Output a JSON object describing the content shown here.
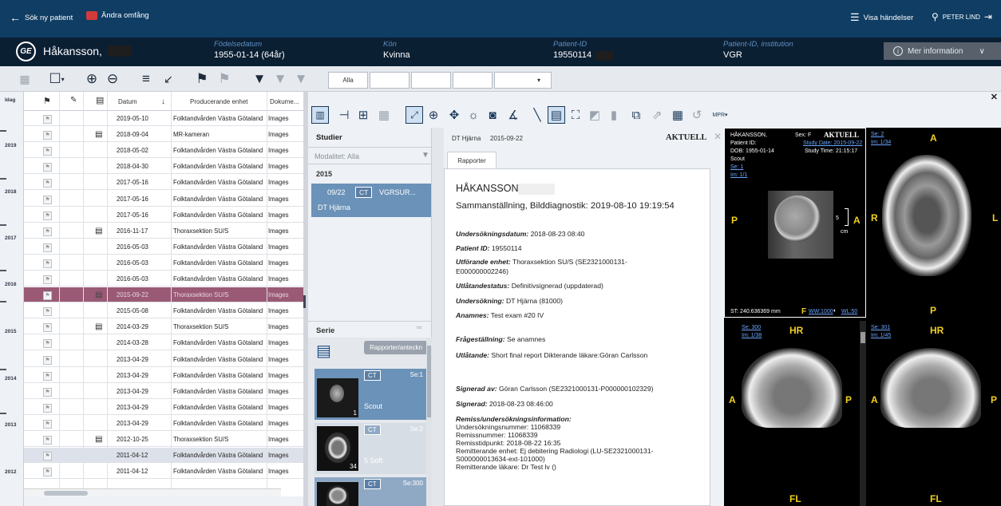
{
  "topbar": {
    "search_patient": "Sök ny patient",
    "change_scope": "Ändra omfång",
    "show_events": "Visa händelser",
    "user": "PETER LIND"
  },
  "patient": {
    "name": "Håkansson,",
    "dob_label": "Födelsedatum",
    "dob": "1955-01-14 (64år)",
    "sex_label": "Kön",
    "sex": "Kvinna",
    "pid_label": "Patient-ID",
    "pid": "19550114",
    "inst_label": "Patient-ID, institution",
    "inst": "VGR",
    "more_info": "Mer information"
  },
  "filter": {
    "all": "Alla"
  },
  "timeline": {
    "top": "Idag",
    "years": [
      "2019",
      "2018",
      "2017",
      "2016",
      "2015",
      "2014",
      "2013",
      "2012"
    ]
  },
  "table": {
    "headers": {
      "date": "Datum",
      "unit": "Producerande enhet",
      "doc": "Dokume..."
    },
    "rows": [
      {
        "date": "2019-05-10",
        "unit": "Folktandvården Västra Götaland",
        "doc": "Images",
        "icon": false
      },
      {
        "date": "2018-09-04",
        "unit": "MR-kameran",
        "doc": "Images",
        "icon": true
      },
      {
        "date": "2018-05-02",
        "unit": "Folktandvården Västra Götaland",
        "doc": "Images",
        "icon": false
      },
      {
        "date": "2018-04-30",
        "unit": "Folktandvården Västra Götaland",
        "doc": "Images",
        "icon": false
      },
      {
        "date": "2017-05-16",
        "unit": "Folktandvården Västra Götaland",
        "doc": "Images",
        "icon": false
      },
      {
        "date": "2017-05-16",
        "unit": "Folktandvården Västra Götaland",
        "doc": "Images",
        "icon": false
      },
      {
        "date": "2017-05-16",
        "unit": "Folktandvården Västra Götaland",
        "doc": "Images",
        "icon": false
      },
      {
        "date": "2016-11-17",
        "unit": "Thoraxsektion SU/S",
        "doc": "Images",
        "icon": true
      },
      {
        "date": "2016-05-03",
        "unit": "Folktandvården Västra Götaland",
        "doc": "Images",
        "icon": false
      },
      {
        "date": "2016-05-03",
        "unit": "Folktandvården Västra Götaland",
        "doc": "Images",
        "icon": false
      },
      {
        "date": "2016-05-03",
        "unit": "Folktandvården Västra Götaland",
        "doc": "Images",
        "icon": false
      },
      {
        "date": "2015-09-22",
        "unit": "Thoraxsektion SU/S",
        "doc": "Images",
        "icon": true
      },
      {
        "date": "2015-05-08",
        "unit": "Folktandvården Västra Götaland",
        "doc": "Images",
        "icon": false
      },
      {
        "date": "2014-03-29",
        "unit": "Thoraxsektion SU/S",
        "doc": "Images",
        "icon": true
      },
      {
        "date": "2014-03-28",
        "unit": "Folktandvården Västra Götaland",
        "doc": "Images",
        "icon": false
      },
      {
        "date": "2013-04-29",
        "unit": "Folktandvården Västra Götaland",
        "doc": "Images",
        "icon": false
      },
      {
        "date": "2013-04-29",
        "unit": "Folktandvården Västra Götaland",
        "doc": "Images",
        "icon": false
      },
      {
        "date": "2013-04-29",
        "unit": "Folktandvården Västra Götaland",
        "doc": "Images",
        "icon": false
      },
      {
        "date": "2013-04-29",
        "unit": "Folktandvården Västra Götaland",
        "doc": "Images",
        "icon": false
      },
      {
        "date": "2013-04-29",
        "unit": "Folktandvården Västra Götaland",
        "doc": "Images",
        "icon": false
      },
      {
        "date": "2012-10-25",
        "unit": "Thoraxsektion SU/S",
        "doc": "Images",
        "icon": true
      },
      {
        "date": "2011-04-12",
        "unit": "Folktandvården Västra Götaland",
        "doc": "Images",
        "icon": false
      },
      {
        "date": "2011-04-12",
        "unit": "Folktandvården Västra Götaland",
        "doc": "Images",
        "icon": false
      }
    ]
  },
  "studies": {
    "title": "Studier",
    "modality": "Modalitet: Alla",
    "year": "2015",
    "item_date": "09/22",
    "item_mod": "CT",
    "item_src": "VGRSUR...",
    "item_desc": "DT Hjärna"
  },
  "serie": {
    "title": "Serie",
    "reports_btn": "Rapporter/anteckn",
    "items": [
      {
        "mod": "CT",
        "se": "Se:1",
        "count": "1",
        "name": "Scout"
      },
      {
        "mod": "CT",
        "se": "Se:2",
        "count": "34",
        "name": "5 Soft"
      },
      {
        "mod": "CT",
        "se": "Se:300",
        "count": "",
        "name": ""
      }
    ]
  },
  "report": {
    "header_desc": "DT Hjärna",
    "header_date": "2015-09-22",
    "status": "AKTUELL",
    "tab": "Rapporter",
    "patient": "HÅKANSSON",
    "heading": "Sammanställning, Bilddiagnostik: 2019-08-10 19:19:54",
    "lines": [
      {
        "k": "Undersökningsdatum:",
        "v": " 2018-08-23 08:40"
      },
      {
        "k": "Patient ID:",
        "v": " 19550114"
      },
      {
        "k": "Utförande enhet:",
        "v": " Thoraxsektion SU/S (SE2321000131-"
      },
      {
        "k": "",
        "v": "E000000002246)"
      },
      {
        "k": "Utlåtandestatus:",
        "v": " Definitivsignerad (uppdaterad)"
      },
      {
        "k": "Undersökning:",
        "v": " DT Hjärna (81000)"
      },
      {
        "k": "Anamnes:",
        "v": " Test exam #20 IV"
      },
      {
        "k": "Frågeställning:",
        "v": " Se anamnes"
      },
      {
        "k": "Utlåtande:",
        "v": " Short final report Dikterande läkare:Göran Carlsson"
      },
      {
        "k": "Signerad av:",
        "v": "  Göran Carlsson (SE2321000131-P000000102329)"
      },
      {
        "k": "Signerad:",
        "v": "  2018-08-23 08:46:00"
      },
      {
        "k": "Remiss/undersökningsinformation:",
        "v": ""
      },
      {
        "k": "",
        "v": "Undersökningsnummer: 11068339"
      },
      {
        "k": "",
        "v": "Remissnummer: 11068339"
      },
      {
        "k": "",
        "v": "Remisstidpunkt: 2018-08-22 16:35"
      },
      {
        "k": "",
        "v": "Remitterande enhet: Ej debitering Radiologi (LU-SE2321000131-"
      },
      {
        "k": "",
        "v": "S000000013634-ext-101000)"
      },
      {
        "k": "",
        "v": "Remitterande läkare: Dr Test lv ()"
      }
    ]
  },
  "viewer1": {
    "name": "HÅKANSSON,",
    "sex": "Sex: F",
    "status": "AKTUELL",
    "pid": "Patient ID:",
    "study_date": "Study Date: 2015-09-22",
    "dob": "DOB: 1955-01-14",
    "study_time": "Study Time: 21:15:17",
    "desc": "Scout",
    "se": "Se: 1",
    "im": "Im: 1/1",
    "st": "ST: 240.636369 mm",
    "ww": "WW:1000",
    "wl": "WL:50",
    "orient_p": "P",
    "orient_a": "A",
    "scale": "5",
    "unit": "cm"
  },
  "viewer2": {
    "se": "Se: 2",
    "im": "Im: 1/34",
    "a": "A",
    "r": "R",
    "l": "L",
    "p": "P"
  },
  "viewer3": {
    "se": "Se: 300",
    "im": "Im: 1/38",
    "hr": "HR",
    "a": "A",
    "p": "P",
    "fl": "FL"
  },
  "viewer4": {
    "se": "Se: 301",
    "im": "Im: 1/45",
    "hr": "HR",
    "a": "A",
    "p": "P",
    "fl": "FL"
  }
}
